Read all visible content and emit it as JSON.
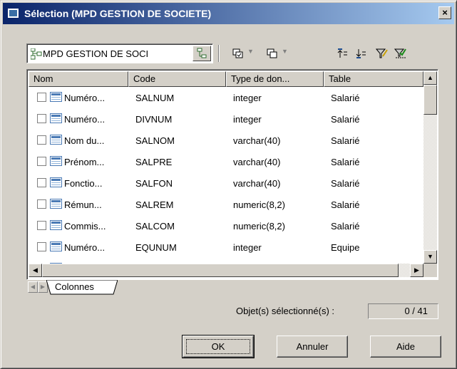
{
  "window": {
    "title": "Sélection (MPD GESTION DE SOCIETE)",
    "close_glyph": "×"
  },
  "toolbar": {
    "model_combo_value": "MPD GESTION DE SOCI",
    "icons": [
      "model-icon",
      "browse-icon",
      "select-all-icon",
      "deselect-icon",
      "move-up-icon",
      "move-down-icon",
      "filter-icon",
      "clear-filter-icon"
    ]
  },
  "columns": {
    "headers": [
      "Nom",
      "Code",
      "Type de don...",
      "Table"
    ],
    "rows": [
      {
        "name": "Numéro...",
        "code": "SALNUM",
        "type": "integer",
        "table": "Salarié"
      },
      {
        "name": "Numéro...",
        "code": "DIVNUM",
        "type": "integer",
        "table": "Salarié"
      },
      {
        "name": "Nom du...",
        "code": "SALNOM",
        "type": "varchar(40)",
        "table": "Salarié"
      },
      {
        "name": "Prénom...",
        "code": "SALPRE",
        "type": "varchar(40)",
        "table": "Salarié"
      },
      {
        "name": "Fonctio...",
        "code": "SALFON",
        "type": "varchar(40)",
        "table": "Salarié"
      },
      {
        "name": "Rémun...",
        "code": "SALREM",
        "type": "numeric(8,2)",
        "table": "Salarié"
      },
      {
        "name": "Commis...",
        "code": "SALCOM",
        "type": "numeric(8,2)",
        "table": "Salarié"
      },
      {
        "name": "Numéro...",
        "code": "EQUNUM",
        "type": "integer",
        "table": "Equipe"
      }
    ]
  },
  "tabs": [
    {
      "label": "Colonnes"
    }
  ],
  "status": {
    "label": "Objet(s) sélectionné(s) :",
    "value": "0 / 41"
  },
  "buttons": {
    "ok": "OK",
    "cancel": "Annuler",
    "help": "Aide"
  },
  "colors": {
    "title_start": "#0a246a",
    "title_end": "#a6caf0",
    "face": "#d4d0c8"
  }
}
